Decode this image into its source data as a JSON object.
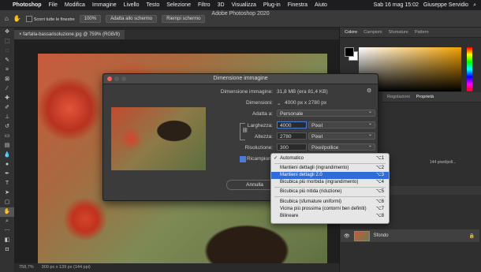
{
  "menubar": {
    "app": "Photoshop",
    "items": [
      "File",
      "Modifica",
      "Immagine",
      "Livello",
      "Testo",
      "Selezione",
      "Filtro",
      "3D",
      "Visualizza",
      "Plug-in",
      "Finestra",
      "Aiuto"
    ],
    "datetime": "Sab 16 mag 15:02",
    "user": "Giuseppe Servidio"
  },
  "optionsbar": {
    "scroll_all": "Scorri tutte le finestre",
    "zoom": "100%",
    "fit_screen": "Adatta allo schermo",
    "fill_screen": "Riempi schermo"
  },
  "window_title": "Adobe Photoshop 2020",
  "document": {
    "tab": "farfalla-bassarisoluzione.jpg @ 759% (RGB/8)",
    "zoom_status": "758,7%",
    "size_status": "300 px x 139 px (144 ppi)"
  },
  "panels": {
    "color_tabs": [
      "Colore",
      "Campioni",
      "Sfumature",
      "Pattern"
    ],
    "props_tabs": [
      "Regolazioni",
      "Proprietà"
    ],
    "props_value": "144 pixel/poll...",
    "layer_name": "Sfondo"
  },
  "dialog": {
    "title": "Dimensione immagine",
    "size_label": "Dimensione immagine:",
    "size_value": "31,8 MB (era 81,4 KB)",
    "dims_label": "Dimensioni:",
    "dims_value": "4000 px x 2780 px",
    "fit_label": "Adatta a:",
    "fit_value": "Personale",
    "width_label": "Larghezza:",
    "width_value": "4000",
    "width_unit": "Pixel",
    "height_label": "Altezza:",
    "height_value": "2780",
    "height_unit": "Pixel",
    "res_label": "Risoluzione:",
    "res_value": "300",
    "res_unit": "Pixel/pollice",
    "resample_label": "Ricampiona:",
    "cancel": "Annulla"
  },
  "resample_menu": [
    {
      "label": "Automatico",
      "shortcut": "⌥1",
      "checked": true
    },
    {
      "label": "Mantieni dettagli (ingrandimento)",
      "shortcut": "⌥2"
    },
    {
      "label": "Mantieni dettagli 2.0",
      "shortcut": "⌥3",
      "highlighted": true
    },
    {
      "label": "Bicubica più morbida (ingrandimento)",
      "shortcut": "⌥4"
    },
    {
      "label": "Bicubica più nitida (riduzione)",
      "shortcut": "⌥5"
    },
    {
      "label": "Bicubica (sfumature uniformi)",
      "shortcut": "⌥6"
    },
    {
      "label": "Vicina più prossima (contorni ben definiti)",
      "shortcut": "⌥7"
    },
    {
      "label": "Bilineare",
      "shortcut": "⌥8"
    }
  ],
  "colors": {
    "accent": "#2f6bd9",
    "dialog_bg": "#3b3b3b",
    "foreground_swatch": "#000000",
    "background_swatch": "#ffffff"
  }
}
